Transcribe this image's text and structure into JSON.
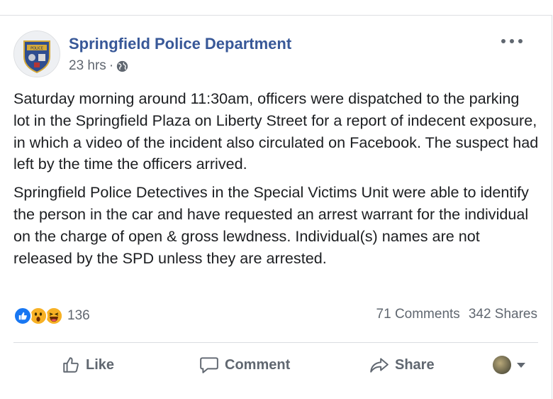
{
  "post": {
    "page_name": "Springfield Police Department",
    "timestamp": "23 hrs",
    "separator": "·",
    "audience_icon": "globe-icon",
    "avatar_badge_text": "POLICE",
    "paragraphs": [
      "Saturday morning around 11:30am, officers were dispatched to the parking lot in the Springfield Plaza on Liberty Street for a report of indecent exposure, in which a video of the incident also circulated on Facebook. The suspect had left by the time the officers arrived.",
      "Springfield Police Detectives in the Special Victims Unit were able to identify the person in the car and have requested an arrest warrant for the individual on the charge of open & gross lewdness. Individual(s) names are not released by the SPD unless they are arrested."
    ]
  },
  "stats": {
    "reactions": [
      "like",
      "wow",
      "haha"
    ],
    "reaction_count": "136",
    "comments": "71 Comments",
    "shares": "342 Shares"
  },
  "actions": {
    "like": "Like",
    "comment": "Comment",
    "share": "Share"
  },
  "colors": {
    "page_name": "#385898",
    "muted_text": "#606770",
    "like_blue": "#1877f2",
    "emoji_yellow": "#f7b125"
  }
}
